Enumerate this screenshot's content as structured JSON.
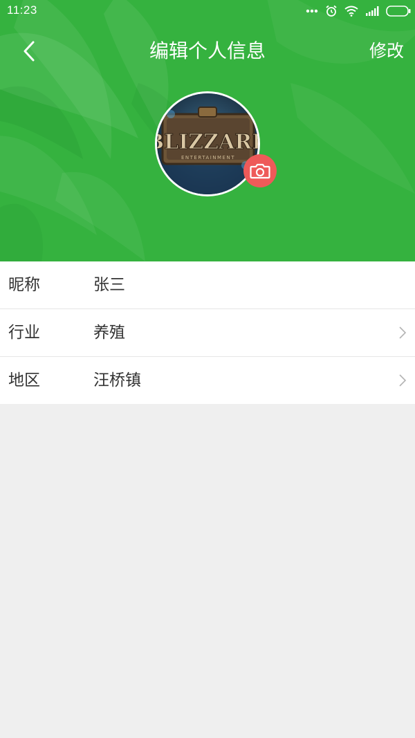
{
  "status_bar": {
    "time": "11:23"
  },
  "nav": {
    "title": "编辑个人信息",
    "action_label": "修改",
    "back_icon": "chevron-left-icon"
  },
  "profile": {
    "avatar_icon": "blizzard-logo",
    "avatar_wordmark": "BLIZZARD",
    "avatar_subtitle": "ENTERTAINMENT",
    "camera_icon": "camera-icon"
  },
  "fields": [
    {
      "label": "昵称",
      "value": "张三",
      "has_arrow": false
    },
    {
      "label": "行业",
      "value": "养殖",
      "has_arrow": true
    },
    {
      "label": "地区",
      "value": "汪桥镇",
      "has_arrow": true
    }
  ],
  "colors": {
    "header_green": "#35b23f",
    "camera_red": "#ee5a59",
    "page_background": "#efefef"
  }
}
